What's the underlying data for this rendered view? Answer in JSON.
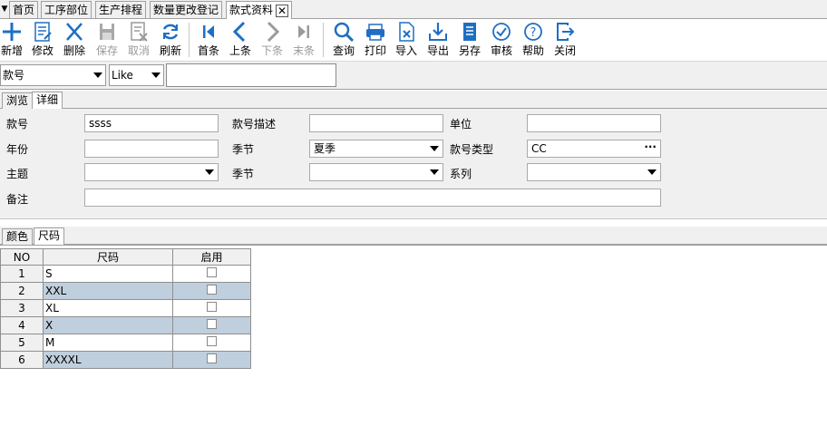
{
  "tabs": [
    {
      "label": "首页"
    },
    {
      "label": "工序部位"
    },
    {
      "label": "生产排程"
    },
    {
      "label": "数量更改登记"
    },
    {
      "label": "款式资料"
    }
  ],
  "toolbar": {
    "new": "新增",
    "edit": "修改",
    "delete": "删除",
    "save": "保存",
    "cancel": "取消",
    "refresh": "刷新",
    "first": "首条",
    "prev": "上条",
    "next": "下条",
    "last": "末条",
    "query": "查询",
    "print": "打印",
    "import": "导入",
    "export": "导出",
    "saveas": "另存",
    "audit": "审核",
    "help": "帮助",
    "close": "关闭"
  },
  "filter": {
    "field": "款号",
    "operator": "Like",
    "value": ""
  },
  "view_tabs": [
    {
      "label": "浏览"
    },
    {
      "label": "详细"
    }
  ],
  "form": {
    "style_no_label": "款号",
    "style_no": "ssss",
    "style_desc_label": "款号描述",
    "style_desc": "",
    "unit_label": "单位",
    "unit": "",
    "year_label": "年份",
    "year": "",
    "season_label": "季节",
    "season": "夏季",
    "style_type_label": "款号类型",
    "style_type": "CC",
    "theme_label": "主题",
    "theme": "",
    "season2_label": "季节",
    "season2": "",
    "series_label": "系列",
    "series": "",
    "remark_label": "备注",
    "remark": ""
  },
  "bottom_tabs": [
    {
      "label": "颜色"
    },
    {
      "label": "尺码"
    }
  ],
  "grid": {
    "headers": {
      "no": "NO",
      "size": "尺码",
      "enabled": "启用"
    },
    "rows": [
      {
        "no": "1",
        "size": "S",
        "enabled": false
      },
      {
        "no": "2",
        "size": "XXL",
        "enabled": false
      },
      {
        "no": "3",
        "size": "XL",
        "enabled": false
      },
      {
        "no": "4",
        "size": "X",
        "enabled": false
      },
      {
        "no": "5",
        "size": "M",
        "enabled": false
      },
      {
        "no": "6",
        "size": "XXXXL",
        "enabled": false
      }
    ]
  },
  "colors": {
    "icon_blue": "#1e6fc4",
    "disabled_gray": "#9a9a9a",
    "alt_row": "#c0cfdd",
    "panel_bg": "#f0f0f0"
  }
}
